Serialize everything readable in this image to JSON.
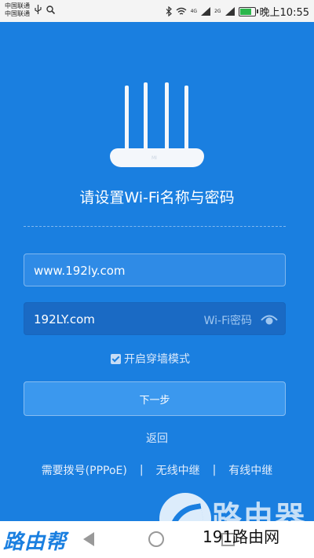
{
  "status_bar": {
    "carrier_1": "中国联通",
    "carrier_2": "中国联通",
    "network_1": "4G",
    "network_2": "2G",
    "time": "晚上10:55"
  },
  "page": {
    "title": "请设置Wi-Fi名称与密码",
    "router_logo": "MI",
    "ssid_value": "www.192ly.com",
    "password_value": "192LY.com",
    "password_placeholder": "Wi-Fi密码",
    "wall_mode_label": "开启穿墙模式",
    "wall_mode_checked": true,
    "next_button": "下一步",
    "back_link": "返回",
    "mode_links": [
      "需要拨号(PPPoE)",
      "无线中继",
      "有线中继"
    ],
    "separator": "|"
  },
  "watermark": {
    "left_text": "路由帮",
    "right_text": "191路由网",
    "overlay_text": "路由器"
  },
  "colors": {
    "background": "#1a7fe0",
    "accent": "#3b98ee"
  }
}
